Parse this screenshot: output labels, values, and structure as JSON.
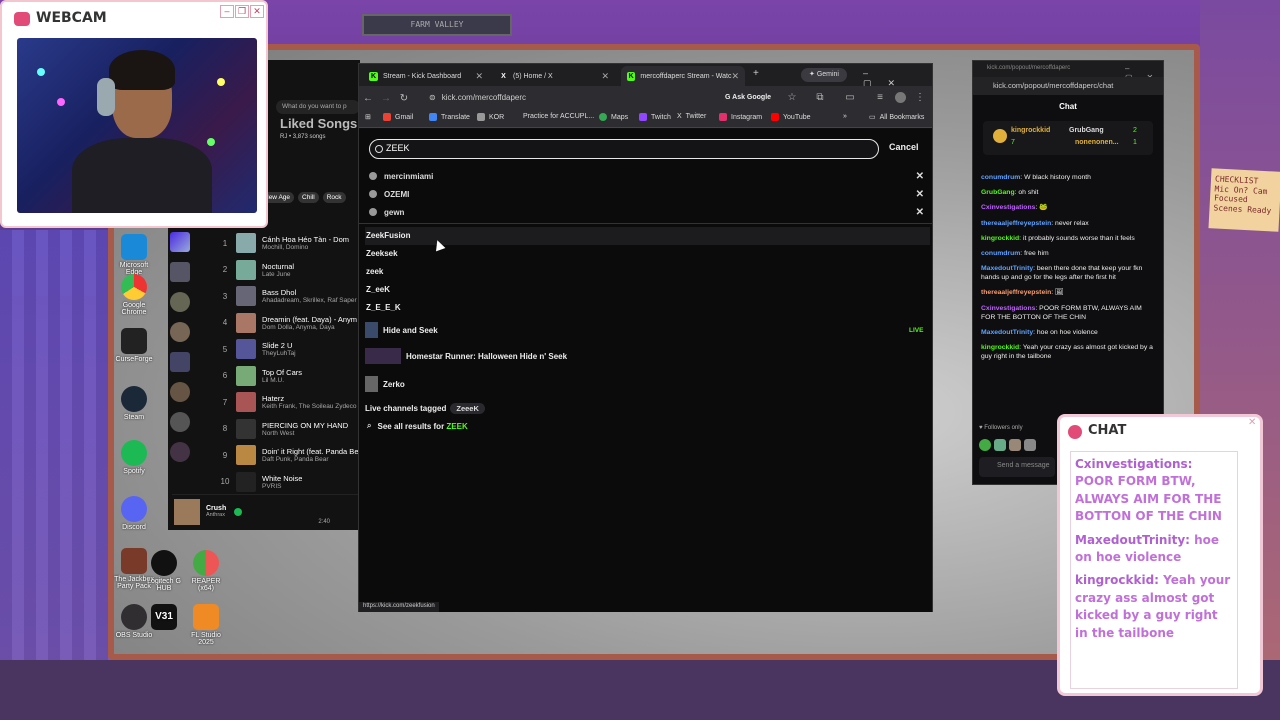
{
  "webcam": {
    "title": "WEBCAM",
    "buttons": [
      "–",
      "❐",
      "✕"
    ]
  },
  "background": {
    "sign": "FARM VALLEY",
    "note": "CHECKLIST Mic On? Cam Focused Scenes Ready"
  },
  "desktop_icons": [
    {
      "label": "Microsoft Edge"
    },
    {
      "label": "Google Chrome"
    },
    {
      "label": "CurseForge"
    },
    {
      "label": "Steam"
    },
    {
      "label": "Spotify"
    },
    {
      "label": "Discord"
    },
    {
      "label": "The Jackbox Party Pack"
    },
    {
      "label": "Logitech G HUB"
    },
    {
      "label": "REAPER (x64)"
    },
    {
      "label": "OBS Studio"
    },
    {
      "label": "V31"
    },
    {
      "label": "FL Studio 2025"
    }
  ],
  "spotify": {
    "search_placeholder": "What do you want to p",
    "playlist_title": "Liked Songs",
    "playlist_meta": "RJ • 3,873 songs",
    "filters": [
      "New Age",
      "Chill",
      "Rock"
    ],
    "tracks": [
      {
        "n": "1",
        "title": "Cánh Hoa Héo Tàn - Dom",
        "artist": "Mochill, Domino"
      },
      {
        "n": "2",
        "title": "Nocturnal",
        "artist": "Late June"
      },
      {
        "n": "3",
        "title": "Bass Dhol",
        "artist": "Ahadadream, Skrillex, Raf Saper"
      },
      {
        "n": "4",
        "title": "Dreamin (feat. Daya) - Anym",
        "artist": "Dom Dolla, Anyma, Daya"
      },
      {
        "n": "5",
        "title": "Slide 2 U",
        "artist": "TheyLuhTaj"
      },
      {
        "n": "6",
        "title": "Top Of Cars",
        "artist": "Lil M.U."
      },
      {
        "n": "7",
        "title": "Haterz",
        "artist": "Keith Frank, The Soileau Zydeco"
      },
      {
        "n": "8",
        "title": "PIERCING ON MY HAND",
        "artist": "North West"
      },
      {
        "n": "9",
        "title": "Doin' it Right (feat. Panda Be",
        "artist": "Daft Punk, Panda Bear"
      },
      {
        "n": "10",
        "title": "White Noise",
        "artist": "PVRIS"
      }
    ],
    "now_playing": {
      "title": "Crush",
      "artist": "Anthrax",
      "time": "2:40"
    }
  },
  "browser": {
    "tabs": [
      {
        "label": "Stream - Kick Dashboard"
      },
      {
        "label": "(5) Home / X"
      },
      {
        "label": "mercoffdaperc Stream - Watc"
      }
    ],
    "gemini": "Gemini",
    "url": "kick.com/mercoffdaperc",
    "ask_google": "Ask Google",
    "bookmarks": [
      "Gmail",
      "Translate",
      "KOR",
      "Practice for ACCUPL...",
      "Maps",
      "Twitch",
      "Twitter",
      "Instagram",
      "YouTube"
    ],
    "all_bookmarks": "All Bookmarks",
    "search_value": "ZEEK",
    "cancel": "Cancel",
    "history": [
      "mercinmiami",
      "OZEMI",
      "gewn"
    ],
    "suggestions": [
      "ZeekFusion",
      "Zeeksek",
      "zeek",
      "Z_eeK",
      "Z_E_E_K"
    ],
    "categories": [
      {
        "name": "Hide and Seek",
        "badge": "LIVE"
      },
      {
        "name": "Homestar Runner: Halloween Hide n' Seek",
        "badge": ""
      },
      {
        "name": "Zerko",
        "badge": ""
      }
    ],
    "live_tagged_label": "Live channels tagged",
    "live_tag": "ZeeeK",
    "see_all_prefix": "See all results for",
    "see_all_query": "ZEEK",
    "status_url": "https://kick.com/zeekfusion"
  },
  "chat_popout": {
    "window_url": "kick.com/popout/mercoffdaperc",
    "url": "kick.com/popout/mercoffdaperc/chat",
    "title": "Chat",
    "pinned": {
      "top_user": "kingrockkid",
      "top_count": "7",
      "second": "GrubGang",
      "second_count": "2",
      "third": "nonenonen...",
      "third_count": "1"
    },
    "messages": [
      {
        "user": "conumdrum",
        "text": "W black history month",
        "color": "#5fa3ff"
      },
      {
        "user": "GrubGang",
        "text": "oh shit",
        "color": "#53fc18"
      },
      {
        "user": "Cxinvestigations",
        "text": "",
        "color": "#c060ff"
      },
      {
        "user": "thereaaljeffreyepstein",
        "text": "never relax",
        "color": "#5fa3ff"
      },
      {
        "user": "kingrockkid",
        "text": "it probably sounds worse than it feels",
        "color": "#53fc18"
      },
      {
        "user": "conumdrum",
        "text": "free him",
        "color": "#5fa3ff"
      },
      {
        "user": "MaxedoutTrinity",
        "text": "been there done that keep your fkn hands up and go for the legs after the first hit",
        "color": "#5fa3ff"
      },
      {
        "user": "thereaaljeffreyepstein",
        "text": "",
        "color": "#ff9a6a"
      },
      {
        "user": "Cxinvestigations",
        "text": "POOR FORM BTW, ALWAYS AIM FOR THE BOTTON OF THE CHIN",
        "color": "#c060ff"
      },
      {
        "user": "MaxedoutTrinity",
        "text": "hoe on hoe violence",
        "color": "#5fa3ff"
      },
      {
        "user": "kingrockkid",
        "text": "Yeah your crazy ass almost got kicked by a guy right in the tailbone",
        "color": "#53fc18"
      }
    ],
    "followers_only": "Followers only",
    "send_placeholder": "Send a message"
  },
  "overlay_chat": {
    "title": "CHAT",
    "messages": [
      {
        "user": "Cxinvestigations:",
        "text": "POOR FORM BTW, ALWAYS AIM FOR THE BOTTON OF THE CHIN"
      },
      {
        "user": "MaxedoutTrinity:",
        "text": "hoe on hoe violence"
      },
      {
        "user": "kingrockkid:",
        "text": "Yeah your crazy ass almost got kicked by a guy right in the tailbone"
      }
    ]
  }
}
